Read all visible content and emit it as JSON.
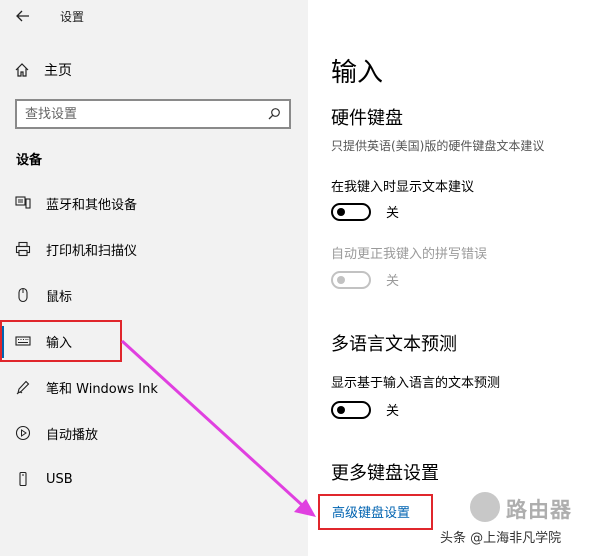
{
  "window": {
    "title": "设置"
  },
  "sidebar": {
    "home_label": "主页",
    "search": {
      "placeholder": "查找设置"
    },
    "section_title": "设备",
    "items": [
      {
        "label": "蓝牙和其他设备",
        "icon": "bluetooth-devices-icon"
      },
      {
        "label": "打印机和扫描仪",
        "icon": "printer-icon"
      },
      {
        "label": "鼠标",
        "icon": "mouse-icon"
      },
      {
        "label": "输入",
        "icon": "keyboard-icon",
        "selected": true
      },
      {
        "label": "笔和 Windows Ink",
        "icon": "pen-icon"
      },
      {
        "label": "自动播放",
        "icon": "autoplay-icon"
      },
      {
        "label": "USB",
        "icon": "usb-icon"
      }
    ]
  },
  "main": {
    "title": "输入",
    "hardware": {
      "heading": "硬件键盘",
      "desc": "只提供英语(美国)版的硬件键盘文本建议",
      "setting1": {
        "label": "在我键入时显示文本建议",
        "state": "关"
      },
      "setting2": {
        "label": "自动更正我键入的拼写错误",
        "state": "关",
        "disabled": true
      }
    },
    "multilang": {
      "heading": "多语言文本预测",
      "setting": {
        "label": "显示基于输入语言的文本预测",
        "state": "关"
      }
    },
    "more": {
      "heading": "更多键盘设置",
      "link": "高级键盘设置"
    }
  },
  "watermark": {
    "brand": "路由器",
    "credit": "头条 @上海非凡学院"
  },
  "colors": {
    "accent": "#0063b1",
    "highlight": "#e0262c",
    "arrow": "#e040e0",
    "sidebar_bg": "#f2f2f2"
  }
}
